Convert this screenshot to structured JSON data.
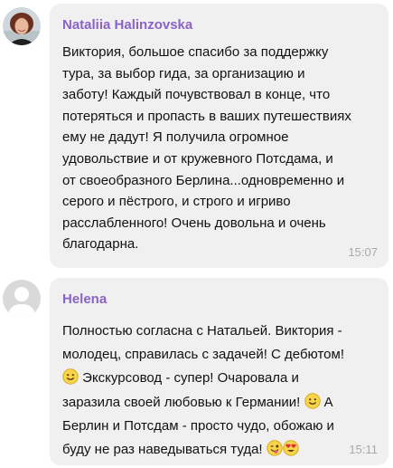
{
  "messages": [
    {
      "sender": "Nataliia Halinzovska",
      "avatar_icon": "user-photo",
      "text": "Виктория, большое спасибо за поддержку\nтура, за выбор гида, за организацию и\nзаботу! Каждый почувствовал в конце, что\nпотеряться и пропасть в ваших путешествиях\nему не дадут!  Я получила огромное\nудовольствие и от кружевного Потсдама, и\nот своеобразного Берлина...одновременно и\nсерого и пёстрого, и строго и игриво\nрасслабленного! Очень довольна и очень\nблагодарна.",
      "time": "15:07"
    },
    {
      "sender": "Helena",
      "avatar_icon": "default-avatar",
      "text_parts": [
        "Полностью согласна с Натальей. Виктория -\nмолодец, справилась с задачей! С дебютом!\n",
        " Экскурсовод - супер! Очаровала и\nзаразила своей любовью к Германии! ",
        " А\nБерлин и Потсдам - просто чудо, обожаю и\nбуду не раз наведываться туда! "
      ],
      "emojis": [
        "smile-emoji",
        "smile-emoji",
        "wink-tongue-emoji",
        "heart-eyes-emoji"
      ],
      "time": "15:11"
    }
  ],
  "colors": {
    "bubble": "#f0f0f0",
    "sender": "#8a63c9",
    "time": "#a9a9a9"
  }
}
